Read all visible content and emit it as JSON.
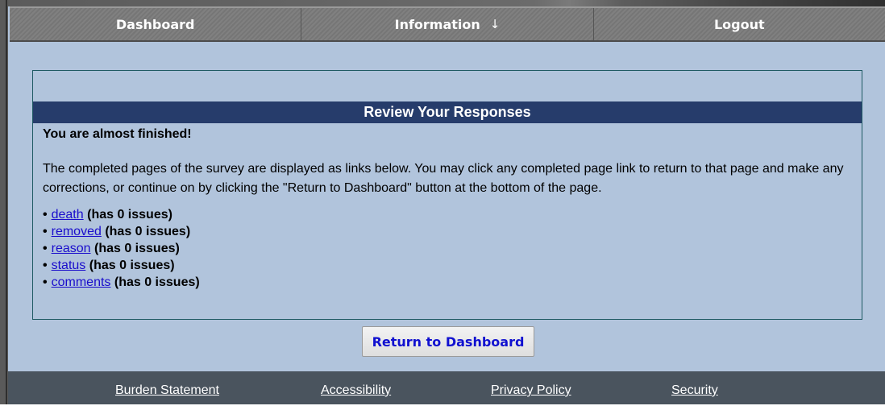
{
  "nav": {
    "items": [
      {
        "label": "Dashboard"
      },
      {
        "label": "Information",
        "arrow": "↓"
      },
      {
        "label": "Logout"
      }
    ]
  },
  "panel": {
    "title": "Review Your Responses",
    "heading": "You are almost finished!",
    "instructions": "The completed pages of the survey are displayed as links below. You may click any completed page link to return to that page and make any corrections, or continue on by clicking the \"Return to Dashboard\" button at the bottom of the page.",
    "pages": [
      {
        "link": "death",
        "status": "(has 0 issues)"
      },
      {
        "link": "removed",
        "status": "(has 0 issues)"
      },
      {
        "link": "reason",
        "status": "(has 0 issues)"
      },
      {
        "link": "status",
        "status": "(has 0 issues)"
      },
      {
        "link": "comments",
        "status": "(has 0 issues)"
      }
    ],
    "bullet": "•"
  },
  "actions": {
    "return_label": "Return to Dashboard"
  },
  "footer": {
    "links": [
      "Burden Statement",
      "Accessibility",
      "Privacy Policy",
      "Security"
    ]
  }
}
